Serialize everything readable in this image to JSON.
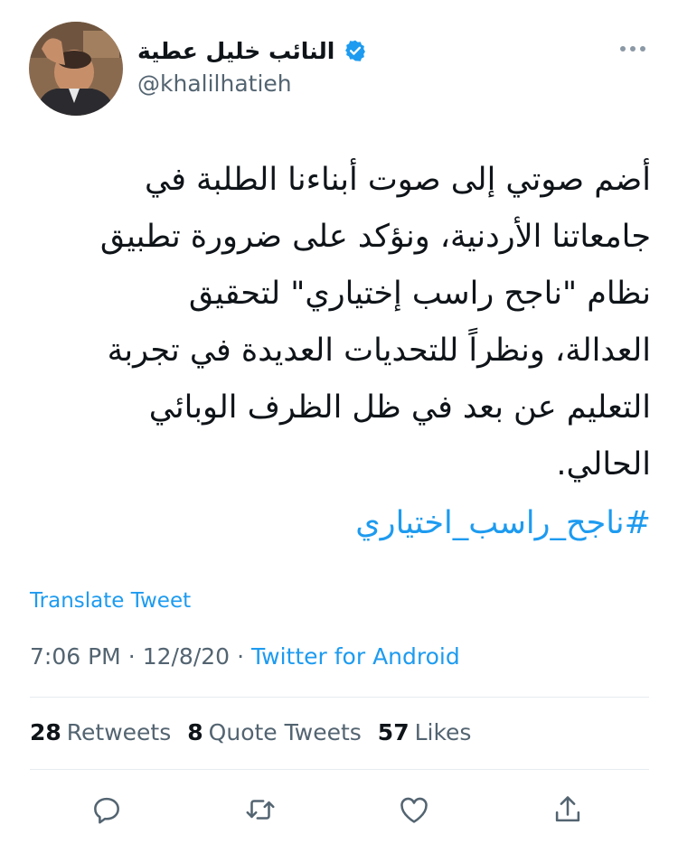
{
  "tweet": {
    "author": {
      "display_name": "النائب خليل عطية",
      "handle": "@khalilhatieh",
      "verified": true
    },
    "text_lines": [
      "أضم صوتي إلى صوت أبناءنا الطلبة في",
      "جامعاتنا الأردنية، ونؤكد على ضرورة تطبيق",
      "نظام \"ناجح راسب إختياري\" لتحقيق",
      "العدالة، ونظراً للتحديات العديدة في تجربة",
      "التعليم عن بعد في ظل الظرف الوبائي",
      "الحالي."
    ],
    "hashtag": "#ناجح_راسب_اختياري",
    "translate_label": "Translate Tweet",
    "time": "7:06 PM",
    "separator": "·",
    "date": "12/8/20",
    "source": "Twitter for Android"
  },
  "stats": [
    {
      "count": "28",
      "label": "Retweets"
    },
    {
      "count": "8",
      "label": "Quote Tweets"
    },
    {
      "count": "57",
      "label": "Likes"
    }
  ],
  "actions": [
    {
      "icon": "reply-icon"
    },
    {
      "icon": "retweet-icon"
    },
    {
      "icon": "like-icon"
    },
    {
      "icon": "share-icon"
    }
  ],
  "colors": {
    "link": "#1d9bf0",
    "secondary_text": "#536471",
    "primary_text": "#0f1419",
    "divider": "#e6ecf0",
    "icon": "#536471"
  }
}
